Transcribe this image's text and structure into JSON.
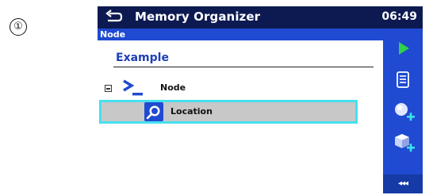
{
  "step_marker": "①",
  "titlebar": {
    "title": "Memory Organizer",
    "clock": "06:49"
  },
  "pathbar": {
    "path": "Node"
  },
  "content": {
    "header": "Example",
    "tree": [
      {
        "label": "Node",
        "icon": "node-icon",
        "expanded": true
      },
      {
        "label": "Location",
        "icon": "location-icon",
        "selected": true
      }
    ]
  },
  "sidebar": {
    "buttons": [
      {
        "name": "start-test",
        "icon": "play-icon"
      },
      {
        "name": "view-list",
        "icon": "list-icon"
      },
      {
        "name": "add-location",
        "icon": "add-location-icon"
      },
      {
        "name": "add-object",
        "icon": "add-object-icon"
      }
    ],
    "more_label": "◂◂◂"
  },
  "colors": {
    "titlebar_bg": "#0d1a52",
    "accent_blue": "#1f4ad1",
    "selection_border": "#46e0ee",
    "selection_bg": "#c8c8c8",
    "play_green": "#2fd04a"
  }
}
